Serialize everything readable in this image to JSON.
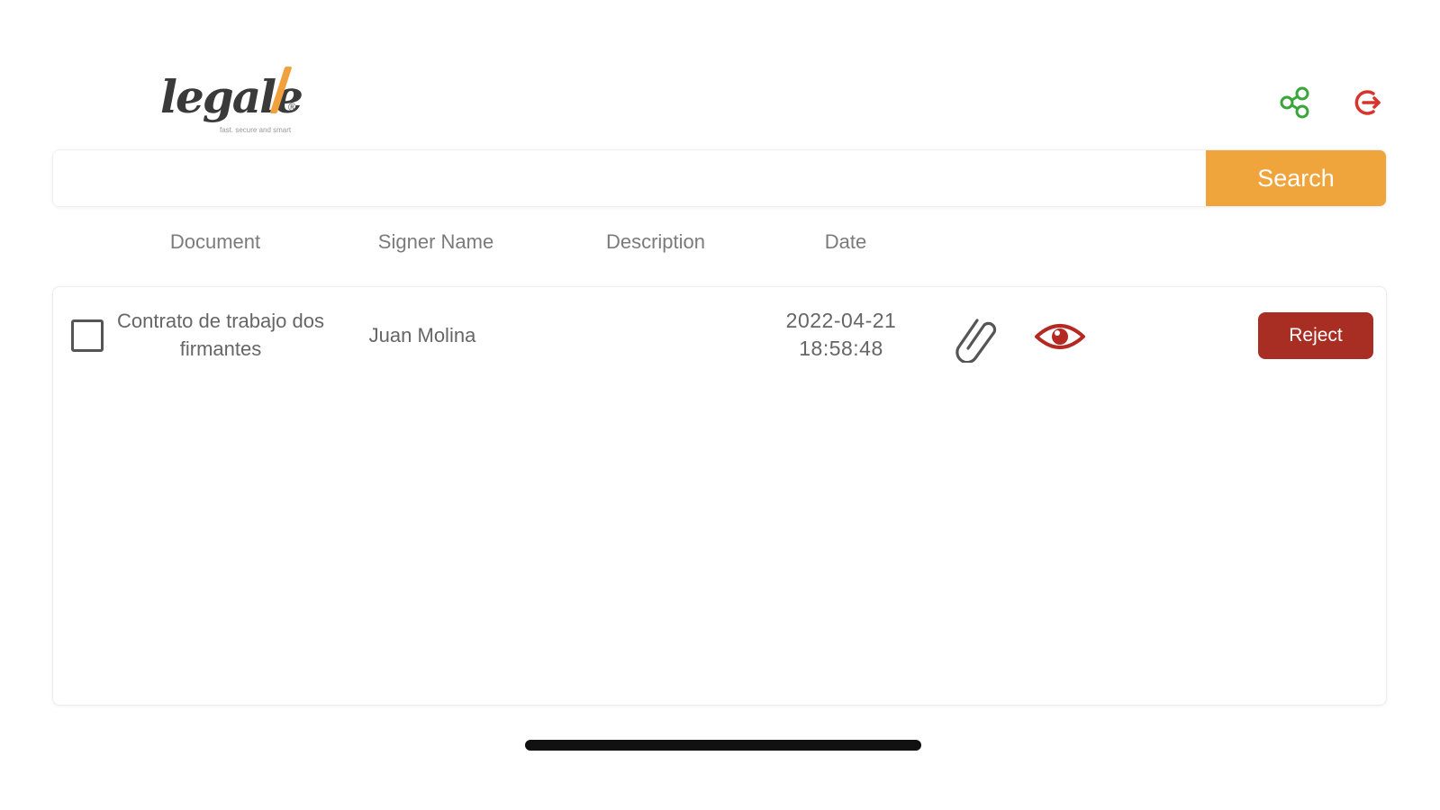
{
  "header": {
    "logo": {
      "word": "legale",
      "registered": "®",
      "tagline": "fast. secure and smart"
    },
    "share_icon": "share-network-icon",
    "logout_icon": "logout-icon"
  },
  "search": {
    "value": "",
    "placeholder": "",
    "button_label": "Search"
  },
  "table": {
    "columns": [
      "Document",
      "Signer Name",
      "Description",
      "Date"
    ],
    "rows": [
      {
        "checked": false,
        "document": "Contrato de trabajo dos firmantes",
        "signer": "Juan Molina",
        "description": "",
        "date": "2022-04-21 18:58:48",
        "attach_icon": "paperclip-icon",
        "view_icon": "eye-icon",
        "reject_label": "Reject"
      }
    ]
  },
  "colors": {
    "accent": "#f0a43c",
    "danger": "#a82d23",
    "share_icon": "#3aa53a",
    "logout_icon": "#d9342b"
  }
}
